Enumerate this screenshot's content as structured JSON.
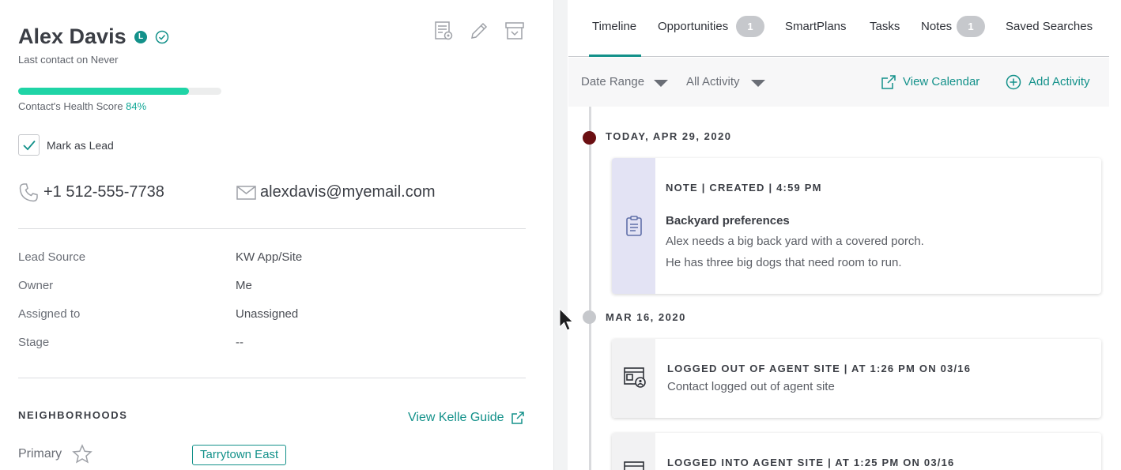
{
  "contact": {
    "name": "Alex Davis",
    "badge": "L",
    "last_contact": "Last contact on Never",
    "health_label": "Contact's Health Score",
    "health_value": "84%",
    "health_score": 0.84,
    "mark_as_lead_label": "Mark as Lead",
    "mark_as_lead_checked": true,
    "phone": "+1 512-555-7738",
    "email": "alexdavis@myemail.com"
  },
  "toolbar": {
    "icons": [
      "contact-settings-icon",
      "edit-pencil-icon",
      "archive-icon"
    ]
  },
  "details": [
    {
      "label": "Lead Source",
      "value": "KW App/Site"
    },
    {
      "label": "Owner",
      "value": "Me"
    },
    {
      "label": "Assigned to",
      "value": "Unassigned"
    },
    {
      "label": "Stage",
      "value": "--"
    }
  ],
  "neighborhoods": {
    "title": "NEIGHBORHOODS",
    "guide_link": "View Kelle Guide",
    "primary_label": "Primary",
    "primary_value": "Tarrytown East"
  },
  "tabs": [
    {
      "label": "Timeline",
      "active": true
    },
    {
      "label": "Opportunities",
      "badge": "1"
    },
    {
      "label": "SmartPlans"
    },
    {
      "label": "Tasks"
    },
    {
      "label": "Notes",
      "badge": "1"
    },
    {
      "label": "Saved Searches"
    }
  ],
  "filters": {
    "date_range": "Date Range",
    "activity": "All Activity",
    "view_calendar": "View Calendar",
    "add_activity": "Add Activity"
  },
  "timeline": {
    "groups": [
      {
        "date": "TODAY, APR 29, 2020",
        "dot_color": "#6b0f12",
        "items": [
          {
            "header": "NOTE | CREATED | 4:59 PM",
            "title": "Backyard preferences",
            "body": "Alex needs a big back yard with a covered porch. He has three big dogs that need room to run.",
            "icon": "clipboard-icon",
            "strip_color": "#e3e3f4"
          }
        ]
      },
      {
        "date": "MAR 16, 2020",
        "dot_color": "#c6c8cc",
        "items": [
          {
            "header": "LOGGED OUT OF AGENT SITE | AT 1:26 PM ON 03/16",
            "body": "Contact logged out of agent site",
            "icon": "agent-site-icon",
            "strip_color": "#f2f2f3"
          },
          {
            "header": "LOGGED INTO AGENT SITE | AT 1:25 PM ON 03/16",
            "icon": "agent-site-icon",
            "strip_color": "#f2f2f3"
          }
        ]
      }
    ]
  },
  "colors": {
    "accent": "#13918a",
    "health_fill": "#1fd4a6",
    "today_dot": "#6b0f12"
  }
}
